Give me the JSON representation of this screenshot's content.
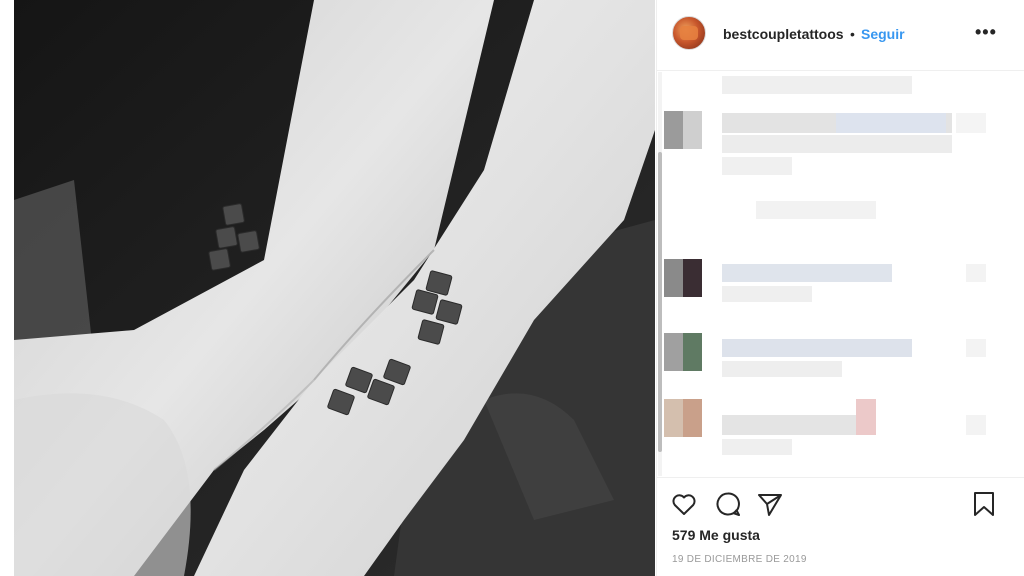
{
  "post": {
    "username": "bestcoupletattoos",
    "separator": "•",
    "follow_label": "Seguir",
    "more_label": "•••",
    "likes_text": "579 Me gusta",
    "date_text": "19 DE DICIEMBRE DE 2019"
  },
  "icons": {
    "like": "heart-icon",
    "comment": "comment-icon",
    "share": "paper-plane-icon",
    "save": "bookmark-icon",
    "more": "ellipsis-icon"
  },
  "colors": {
    "follow_blue": "#3897f0",
    "text_primary": "#262626",
    "text_secondary": "#999999",
    "border": "#efefef"
  }
}
